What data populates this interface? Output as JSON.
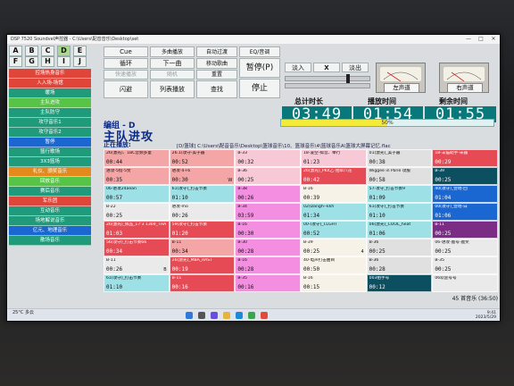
{
  "window": {
    "title": "DSP 7520 Soundvel声控器 - C:\\Users\\配音音乐\\Desktop\\set"
  },
  "letters": [
    {
      "label": "A",
      "active": false
    },
    {
      "label": "B",
      "active": false
    },
    {
      "label": "C",
      "active": false
    },
    {
      "label": "D",
      "active": true
    },
    {
      "label": "E",
      "active": false
    },
    {
      "label": "F",
      "active": false
    },
    {
      "label": "G",
      "active": false
    },
    {
      "label": "H",
      "active": false
    },
    {
      "label": "I",
      "active": false
    },
    {
      "label": "J",
      "active": false
    }
  ],
  "groups": [
    {
      "label": "控场热身音乐",
      "color": "#e0453a"
    },
    {
      "label": "入入场-场馆",
      "color": "#e0453a"
    },
    {
      "label": "暖场",
      "color": "#1f9a7a"
    },
    {
      "label": "主队进攻",
      "color": "#57c447"
    },
    {
      "label": "主队防守",
      "color": "#1f9a7a"
    },
    {
      "label": "攻守音乐1",
      "color": "#1f9a7a"
    },
    {
      "label": "攻守音乐2",
      "color": "#1f9a7a"
    },
    {
      "label": "暂停",
      "color": "#1a67d1"
    },
    {
      "label": "篮行歌场",
      "color": "#1f9a7a"
    },
    {
      "label": "3X3篮场",
      "color": "#1f9a7a"
    },
    {
      "label": "礼仪、颁奖音乐",
      "color": "#e48a1c"
    },
    {
      "label": "回放音乐",
      "color": "#57c447"
    },
    {
      "label": "赛后音乐",
      "color": "#1f9a7a"
    },
    {
      "label": "军乐团",
      "color": "#e0453a"
    },
    {
      "label": "互动音乐",
      "color": "#1f9a7a"
    },
    {
      "label": "场地解说音乐",
      "color": "#1f9a7a"
    },
    {
      "label": "亿元、地理音乐",
      "color": "#1a67d1"
    },
    {
      "label": "散场音乐",
      "color": "#1f9a7a"
    }
  ],
  "controls": {
    "cue": "Cue",
    "multi": "多曲播放",
    "auto": "自动过渡",
    "eq": "EQ/音调",
    "loop": "循环",
    "next": "下一曲",
    "move": "移动歌曲",
    "pause": "暂停(P)",
    "quick": "快速播放",
    "random": "随机",
    "reorder": "重置",
    "flash": "闪避",
    "list_play": "列表播放",
    "find": "查找",
    "stop": "停止",
    "fade_in": "淡入",
    "x": "X",
    "fade_out": "淡出"
  },
  "meters": {
    "left": "左声道",
    "right": "右声道"
  },
  "times": {
    "total_label": "总计时长",
    "total_value": "03:49",
    "played_label": "播放时间",
    "played_value": "01:54",
    "remain_label": "剩余时间",
    "remain_value": "01:55"
  },
  "progress": {
    "percent": 50,
    "label": "50%"
  },
  "group_info": {
    "title": "编组 - D",
    "name": "主队进攻",
    "now_label": "正在播放:",
    "now_path": "[D/篮球]   C:\\Users\\配音音乐\\Desktop\\篮球音乐\\10、篮球音乐\\4\\篮球音乐A\\篮球大屏幕记忆.flac"
  },
  "cells": [
    {
      "name": "26(激光)、1BC音频多量",
      "dur": "00:44",
      "flag": "",
      "color": "#f4a6a6",
      "dark": false
    },
    {
      "name": "26.1(攻守-美子器",
      "dur": "00:52",
      "flag": "",
      "color": "#f4a6a6",
      "dark": false
    },
    {
      "name": "B-33",
      "dur": "00:32",
      "flag": "",
      "color": "#f7c9d6",
      "dark": false
    },
    {
      "name": "18-凌空-拟音、举行",
      "dur": "01:23",
      "flag": "",
      "color": "#f7c9d6",
      "dark": false
    },
    {
      "name": "01(激光)_美子器",
      "dur": "00:38",
      "flag": "",
      "color": "#e0e0e0",
      "dark": false
    },
    {
      "name": "18-羊猫助手-宋器",
      "dur": "00:29",
      "flag": "",
      "color": "#e64a55",
      "dark": true
    },
    {
      "name": "进攻-5指-5赞",
      "dur": "00:35",
      "flag": "",
      "color": "#f4a6a6",
      "dark": false
    },
    {
      "name": "进攻-4+6",
      "dur": "00:30",
      "flag": "W",
      "color": "#f4a6a6",
      "dark": false
    },
    {
      "name": "B-36",
      "dur": "00:25",
      "flag": "",
      "color": "#f7c9d6",
      "dark": false
    },
    {
      "name": "26(激光)_PKK乙-拍单八花",
      "dur": "00:42",
      "flag": "",
      "color": "#e64a55",
      "dark": true
    },
    {
      "name": "Wiggee in Parie  攻服",
      "dur": "00:58",
      "flag": "",
      "color": "#e0e0e0",
      "dark": false
    },
    {
      "name": "B-39",
      "dur": "00:25",
      "flag": "",
      "color": "#0c4f60",
      "dark": true
    },
    {
      "name": "06-进攻24aean",
      "dur": "00:57",
      "flag": "",
      "color": "#9de0e6",
      "dark": false
    },
    {
      "name": "61(攻守)_打击节奏",
      "dur": "01:10",
      "flag": "",
      "color": "#9de0e6",
      "dark": false
    },
    {
      "name": "B-38",
      "dur": "00:26",
      "flag": "",
      "color": "#f38ee0",
      "dark": false
    },
    {
      "name": "B-16",
      "dur": "00:39",
      "flag": "",
      "color": "#f7f2e8",
      "dark": false
    },
    {
      "name": "57-攻守_打击节奏9",
      "dur": "01:09",
      "flag": "",
      "color": "#9de0e6",
      "dark": false
    },
    {
      "name": "40(攻守)_营地-回",
      "dur": "01:04",
      "flag": "",
      "color": "#1a67d1",
      "dark": true
    },
    {
      "name": "B-22",
      "dur": "00:25",
      "flag": "",
      "color": "#eaeaea",
      "dark": false
    },
    {
      "name": "进攻-mo",
      "dur": "00:26",
      "flag": "",
      "color": "#eaeaea",
      "dark": false
    },
    {
      "name": "B-34",
      "dur": "03:59",
      "flag": "",
      "color": "#f38ee0",
      "dark": false
    },
    {
      "name": "02(Dangh--kkh",
      "dur": "01:34",
      "flag": "",
      "color": "#9de0e6",
      "dark": false
    },
    {
      "name": "61(攻守)_打击节奏",
      "dur": "01:10",
      "flag": "",
      "color": "#9de0e6",
      "dark": false
    },
    {
      "name": "00(攻守)_营地-白",
      "dur": "01:06",
      "flag": "",
      "color": "#1a67d1",
      "dark": true
    },
    {
      "name": "26(激光)_佩品_17'3  1369_THAT_heat",
      "dur": "01:03",
      "flag": "",
      "color": "#e64a55",
      "dark": true
    },
    {
      "name": "59(攻守)_打击节奏",
      "dur": "01:20",
      "flag": "",
      "color": "#e64a55",
      "dark": true
    },
    {
      "name": "B-16",
      "dur": "00:30",
      "flag": "",
      "color": "#f38ee0",
      "dark": false
    },
    {
      "name": "00-(攻守)_I.LGHT",
      "dur": "00:52",
      "flag": "",
      "color": "#9de0e6",
      "dark": false
    },
    {
      "name": "06(激光)_COOL_heat",
      "dur": "01:06",
      "flag": "",
      "color": "#9de0e6",
      "dark": false
    },
    {
      "name": "B-11",
      "dur": "00:25",
      "flag": "",
      "color": "#7b2d86",
      "dark": true
    },
    {
      "name": "56(攻守)_打击节奏66",
      "dur": "00:34",
      "flag": "",
      "color": "#e64a55",
      "dark": true
    },
    {
      "name": "B-11",
      "dur": "00:34",
      "flag": "",
      "color": "#f4a6a6",
      "dark": false
    },
    {
      "name": "B-30",
      "dur": "00:28",
      "flag": "",
      "color": "#f38ee0",
      "dark": false
    },
    {
      "name": "B-39",
      "dur": "00:25",
      "flag": "4",
      "color": "#f7f2e8",
      "dark": false
    },
    {
      "name": "B-36",
      "dur": "00:25",
      "flag": "",
      "color": "#e0e0e0",
      "dark": false
    },
    {
      "name": "06-进攻-鹿号-鹿奖",
      "dur": "00:25",
      "flag": "",
      "color": "#eaeaea",
      "dark": false
    },
    {
      "name": "B-11",
      "dur": "00:26",
      "flag": "B",
      "color": "#eaeaea",
      "dark": false
    },
    {
      "name": "26(激光)_MBA_RAST",
      "dur": "00:19",
      "flag": "",
      "color": "#e64a55",
      "dark": true
    },
    {
      "name": "B-16",
      "dur": "00:28",
      "flag": "",
      "color": "#f38ee0",
      "dark": false
    },
    {
      "name": "40-电声打击曲目",
      "dur": "00:50",
      "flag": "",
      "color": "#f7f2e8",
      "dark": false
    },
    {
      "name": "B-36",
      "dur": "00:28",
      "flag": "",
      "color": "#e0e0e0",
      "dark": false
    },
    {
      "name": "B-35",
      "dur": "00:25",
      "flag": "",
      "color": "#eaeaea",
      "dark": false
    },
    {
      "name": "61(攻守)_打击节奏",
      "dur": "01:10",
      "flag": "",
      "color": "#9de0e6",
      "dark": false
    },
    {
      "name": "B-11",
      "dur": "00:16",
      "flag": "",
      "color": "#e64a55",
      "dark": true
    },
    {
      "name": "B-35",
      "dur": "00:16",
      "flag": "",
      "color": "#f38ee0",
      "dark": false
    },
    {
      "name": "B-16",
      "dur": "00:15",
      "flag": "",
      "color": "#f7f2e8",
      "dark": false
    },
    {
      "name": "003拍手号",
      "dur": "00:12",
      "flag": "",
      "color": "#0c4f60",
      "dark": true
    },
    {
      "name": "06欢迎号号",
      "dur": "",
      "flag": "",
      "color": "#eaeaea",
      "dark": false
    }
  ],
  "status": {
    "text": "45 首音乐 (36:50)"
  },
  "taskbar": {
    "weather": "25°C 多云",
    "time": "9:41",
    "date": "2023/5/29"
  }
}
